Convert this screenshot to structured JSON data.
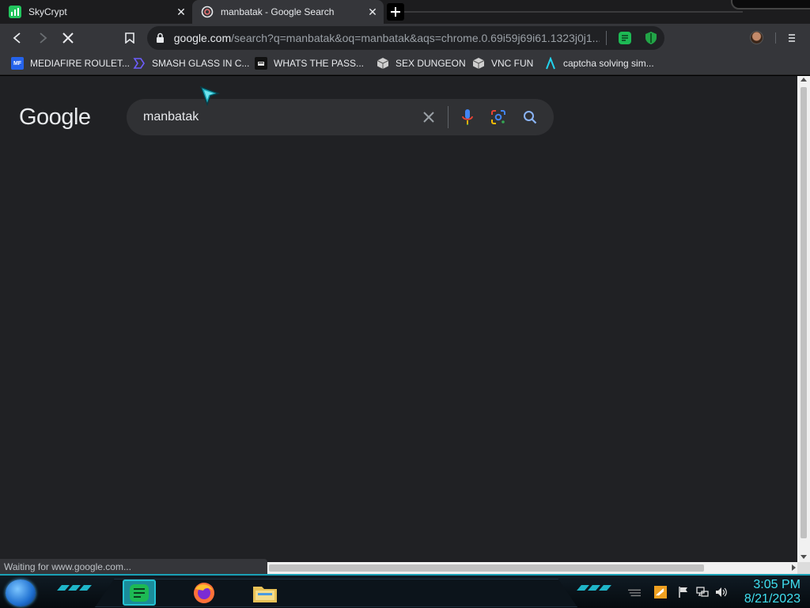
{
  "browser": {
    "tabs": [
      {
        "title": "SkyCrypt",
        "active": false,
        "favicon": "bar-chart-icon",
        "favicon_color": "#22c55e"
      },
      {
        "title": "manbatak - Google Search",
        "active": true,
        "favicon": "google-icon",
        "favicon_color": "#e8eaed"
      }
    ],
    "new_tab_label": "+",
    "address_bar": {
      "host": "google.com",
      "path": "/search?q=manbatak&oq=manbatak&aqs=chrome.0.69i59j69i61.1323j0j1..."
    },
    "loading": true,
    "extensions": [
      {
        "icon": "notes-extension-icon",
        "color": "#1db954"
      },
      {
        "icon": "shield-extension-icon",
        "color": "#22a447"
      }
    ],
    "bookmarks": [
      {
        "label": "MEDIAFIRE ROULET...",
        "icon": "mediafire-icon",
        "color": "#2563eb"
      },
      {
        "label": "SMASH GLASS IN C...",
        "icon": "chevron-bookmark-icon",
        "color": "#6d5dfc"
      },
      {
        "label": "WHATS THE PASS...",
        "icon": "terminal-icon",
        "color": "#111111"
      },
      {
        "label": "SEX DUNGEON",
        "icon": "cube-icon",
        "color": "#cfcfcf"
      },
      {
        "label": "VNC FUN",
        "icon": "cube-icon",
        "color": "#cfcfcf"
      },
      {
        "label": "captcha solving sim...",
        "icon": "lambda-icon",
        "color": "#22d3ee"
      }
    ],
    "status_text": "Waiting for www.google.com..."
  },
  "page": {
    "logo_text": "Google",
    "search_query": "manbatak"
  },
  "taskbar": {
    "time": "3:05 PM",
    "date": "8/21/2023",
    "apps": [
      "notes-app-icon",
      "firefox-icon",
      "file-explorer-icon"
    ],
    "accent_color": "#1aa0b5"
  }
}
